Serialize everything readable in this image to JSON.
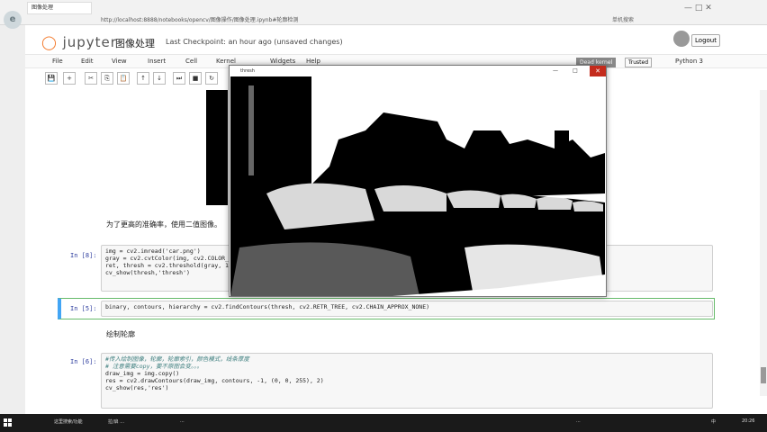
{
  "browser": {
    "tab_title": "图像处理",
    "address": "http://localhost:8888/notebooks/opencv/图像操作/图像处理.ipynb#轮廓检测",
    "right_label_1": "单机搜索",
    "right_label_2": "..."
  },
  "jupyter": {
    "logo": "jupyter",
    "notebook_title": "图像处理",
    "checkpoint": "Last Checkpoint: an hour ago (unsaved changes)",
    "logout": "Logout",
    "menu": [
      "File",
      "Edit",
      "View",
      "Insert",
      "Cell",
      "Kernel",
      "Widgets",
      "Help"
    ],
    "kernel_status": "Dead kernel",
    "trusted": "Trusted",
    "kernel_name": "Python 3",
    "toolbar_buttons": [
      "💾",
      "+",
      "✂",
      "⎘",
      "📋",
      "↑",
      "↓",
      "⏭",
      "■",
      "↻"
    ]
  },
  "cells": {
    "md1": "为了更高的准确率，使用二值图像。",
    "prompt8": "In [8]:",
    "code8": [
      "img = cv2.imread('car.png')",
      "gray = cv2.cvtColor(img, cv2.COLOR_BGR2GRAY)",
      "ret, thresh = cv2.threshold(gray, 127, 255, cv2.THRESH_BINARY)",
      "cv_show(thresh,'thresh')"
    ],
    "prompt5": "In [5]:",
    "code5": "binary, contours, hierarchy = cv2.findContours(thresh, cv2.RETR_TREE, cv2.CHAIN_APPROX_NONE)",
    "md2": "绘制轮廓",
    "prompt6": "In [6]:",
    "code6_comment1": "#传入绘制图像，轮廓，轮廓索引，颜色模式，线条厚度",
    "code6_comment2": "# 注意需要copy，要不原图会变。。。",
    "code6": [
      "draw_img = img.copy()",
      "res = cv2.drawContours(draw_img, contours, -1, (0, 0, 255), 2)",
      "cv_show(res,'res')"
    ]
  },
  "popup": {
    "title": "thresh",
    "min": "—",
    "max": "□",
    "close": "✕"
  },
  "taskbar": {
    "items": [
      "这里搜索/功能",
      "拉/启 ...",
      "...",
      "...",
      "中",
      "20:26"
    ]
  }
}
